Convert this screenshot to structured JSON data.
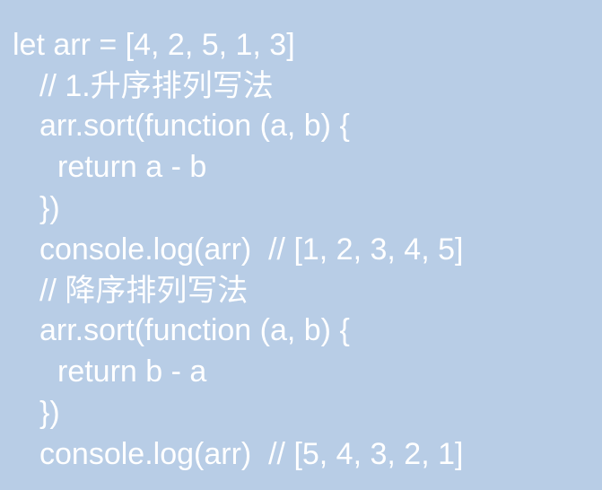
{
  "background_color": "#b8cde6",
  "text_color": "#ffffff",
  "lines": [
    "let arr = [4, 2, 5, 1, 3]",
    "// 1.升序排列写法",
    "arr.sort(function (a, b) {",
    "return a - b",
    "})",
    "console.log(arr)  // [1, 2, 3, 4, 5]",
    "// 降序排列写法",
    "arr.sort(function (a, b) {",
    "return b - a",
    "})",
    "console.log(arr)  // [5, 4, 3, 2, 1]"
  ]
}
